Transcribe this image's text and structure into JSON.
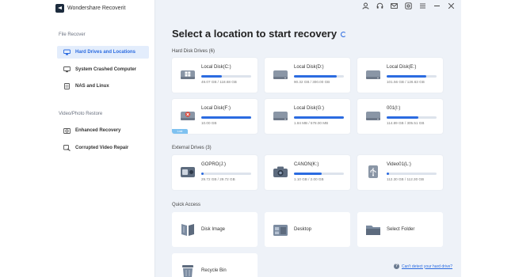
{
  "app": {
    "title": "Wondershare Recoverit"
  },
  "sidebar": {
    "sections": [
      {
        "label": "File Recover",
        "items": [
          {
            "label": "Hard Drives and Locations",
            "icon": "hard-drive-icon",
            "active": true
          },
          {
            "label": "System Crashed Computer",
            "icon": "monitor-icon",
            "active": false
          },
          {
            "label": "NAS and Linux",
            "icon": "nas-icon",
            "active": false
          }
        ]
      },
      {
        "label": "Video/Photo Restore",
        "items": [
          {
            "label": "Enhanced Recovery",
            "icon": "camera-icon",
            "active": false
          },
          {
            "label": "Corrupted Video Repair",
            "icon": "video-repair-icon",
            "active": false
          }
        ]
      }
    ]
  },
  "topbar": {
    "icons": [
      "user-icon",
      "headset-icon",
      "mail-icon",
      "settings-icon",
      "menu-icon",
      "minimize-icon",
      "close-icon"
    ]
  },
  "main": {
    "title": "Select a location to start recovery",
    "hard_disk_label": "Hard Disk Drives (6)",
    "hard_disks": [
      {
        "name": "Local Disk(C:)",
        "usage": "49.07 GB / 118.68 GB",
        "fill": 0.41,
        "icon": "windows-drive-icon"
      },
      {
        "name": "Local Disk(D:)",
        "usage": "90.32 GB / 300.00 GB",
        "fill": 0.86,
        "icon": "drive-icon"
      },
      {
        "name": "Local Disk(E:)",
        "usage": "101.56 GB / 126.63 GB",
        "fill": 0.8,
        "icon": "drive-icon"
      },
      {
        "name": "Local Disk(F:)",
        "usage": "10.00 GB",
        "fill": 1.0,
        "icon": "red-drive-icon",
        "badge": "Lost"
      },
      {
        "name": "Local Disk(G:)",
        "usage": "1.84 MB / 578.00 MB",
        "fill": 1.0,
        "icon": "drive-icon"
      },
      {
        "name": "001(I:)",
        "usage": "114.89 GB / 305.51 GB",
        "fill": 0.63,
        "icon": "drive-icon"
      }
    ],
    "external_label": "External Drives (3)",
    "external_drives": [
      {
        "name": "GOPRO(J:)",
        "usage": "29.72 GB / 29.72 GB",
        "fill": 0.04,
        "icon": "gopro-icon"
      },
      {
        "name": "CANON(K:)",
        "usage": "1.10 GB / 2.00 GB",
        "fill": 0.55,
        "icon": "camera-icon"
      },
      {
        "name": "Video01(L:)",
        "usage": "112.30 GB / 112.30 GB",
        "fill": 0.04,
        "icon": "usb-icon"
      }
    ],
    "quick_label": "Quick Access",
    "quick_access": [
      {
        "name": "Disk Image",
        "icon": "disk-image-icon"
      },
      {
        "name": "Desktop",
        "icon": "desktop-icon"
      },
      {
        "name": "Select Folder",
        "icon": "folder-icon"
      },
      {
        "name": "Recycle Bin",
        "icon": "recycle-bin-icon"
      }
    ],
    "help_text": "Can't detect your hard drive?"
  },
  "colors": {
    "accent": "#2b6be0",
    "background": "#eef2f8",
    "sidebar": "#ffffff"
  }
}
